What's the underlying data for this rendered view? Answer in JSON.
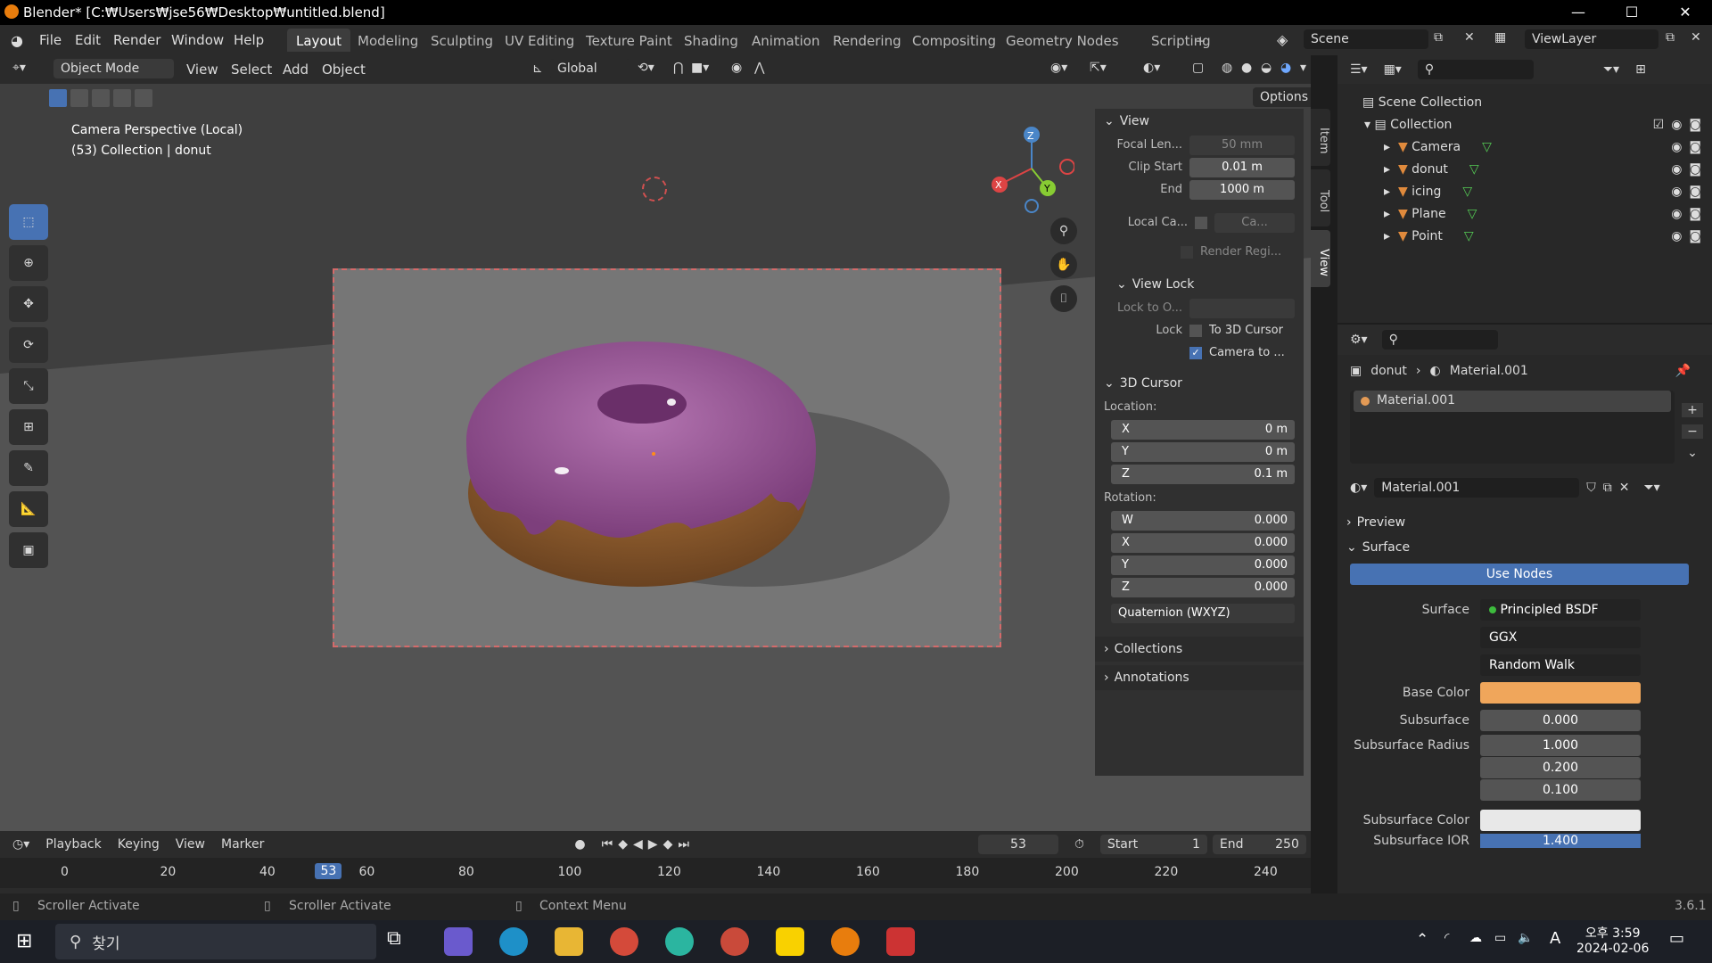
{
  "window": {
    "title": "Blender* [C:₩Users₩jse56₩Desktop₩untitled.blend]",
    "min": "—",
    "max": "☐",
    "close": "✕"
  },
  "menu": {
    "items": [
      "File",
      "Edit",
      "Render",
      "Window",
      "Help"
    ]
  },
  "workspaces": [
    "Layout",
    "Modeling",
    "Sculpting",
    "UV Editing",
    "Texture Paint",
    "Shading",
    "Animation",
    "Rendering",
    "Compositing",
    "Geometry Nodes",
    "Scripting"
  ],
  "workspace_add": "+",
  "scene": {
    "label": "Scene",
    "viewlayer": "ViewLayer"
  },
  "viewport_header": {
    "mode": "Object Mode",
    "menus": [
      "View",
      "Select",
      "Add",
      "Object"
    ],
    "orientation": "Global",
    "options": "Options"
  },
  "viewport": {
    "camera_info": "Camera Perspective (Local)",
    "collection_info": "(53) Collection | donut"
  },
  "gizmo": {
    "z": "Z",
    "x": "X",
    "y": "Y"
  },
  "npanel": {
    "tabs": [
      "Item",
      "Tool",
      "View"
    ],
    "view_title": "View",
    "focal_label": "Focal Len...",
    "focal": "50 mm",
    "clip_start_label": "Clip Start",
    "clip_start": "0.01 m",
    "clip_end_label": "End",
    "clip_end": "1000 m",
    "local_cam_label": "Local Ca...",
    "local_cam": "Ca...",
    "render_region": "Render Regi...",
    "view_lock_title": "View Lock",
    "lock_to_label": "Lock to O...",
    "lock_label": "Lock",
    "to_cursor": "To 3D Cursor",
    "camera_to": "Camera to ...",
    "cursor_title": "3D Cursor",
    "location_label": "Location:",
    "loc": [
      {
        "axis": "X",
        "value": "0 m"
      },
      {
        "axis": "Y",
        "value": "0 m"
      },
      {
        "axis": "Z",
        "value": "0.1 m"
      }
    ],
    "rotation_label": "Rotation:",
    "rot": [
      {
        "axis": "W",
        "value": "0.000"
      },
      {
        "axis": "X",
        "value": "0.000"
      },
      {
        "axis": "Y",
        "value": "0.000"
      },
      {
        "axis": "Z",
        "value": "0.000"
      }
    ],
    "rot_mode": "Quaternion (WXYZ)",
    "collections": "Collections",
    "annotations": "Annotations"
  },
  "outliner": {
    "root": "Scene Collection",
    "collection": "Collection",
    "items": [
      {
        "name": "Camera",
        "color": "#e08a3c"
      },
      {
        "name": "donut",
        "color": "#e08a3c"
      },
      {
        "name": "icing",
        "color": "#e08a3c"
      },
      {
        "name": "Plane",
        "color": "#e08a3c"
      },
      {
        "name": "Point",
        "color": "#e08a3c"
      }
    ]
  },
  "properties": {
    "breadcrumb_obj": "donut",
    "breadcrumb_mat": "Material.001",
    "slot": "Material.001",
    "material": "Material.001",
    "preview": "Preview",
    "surface_section": "Surface",
    "use_nodes": "Use Nodes",
    "surface_label": "Surface",
    "surface_value": "Principled BSDF",
    "distribution": "GGX",
    "sss_method": "Random Walk",
    "base_color_label": "Base Color",
    "base_color": "#f0a65b",
    "subsurface_label": "Subsurface",
    "subsurface": "0.000",
    "sss_radius_label": "Subsurface Radius",
    "sss_radius": [
      "1.000",
      "0.200",
      "0.100"
    ],
    "sss_color_label": "Subsurface Color",
    "sss_color": "#e8e8e8",
    "sss_ior_label": "Subsurface IOR",
    "sss_ior": "1.400"
  },
  "timeline": {
    "menus": [
      "Playback",
      "Keying",
      "View",
      "Marker"
    ],
    "current": "53",
    "start_label": "Start",
    "start": "1",
    "end_label": "End",
    "end": "250",
    "ticks": [
      "0",
      "20",
      "40",
      "60",
      "80",
      "100",
      "120",
      "140",
      "160",
      "180",
      "200",
      "220",
      "240"
    ],
    "frame_marker": "53"
  },
  "status": {
    "left": "Scroller Activate",
    "mid": "Scroller Activate",
    "right": "Context Menu",
    "version": "3.6.1"
  },
  "taskbar": {
    "search": "찾기",
    "time": "오후 3:59",
    "date": "2024-02-06",
    "ime": "A"
  }
}
